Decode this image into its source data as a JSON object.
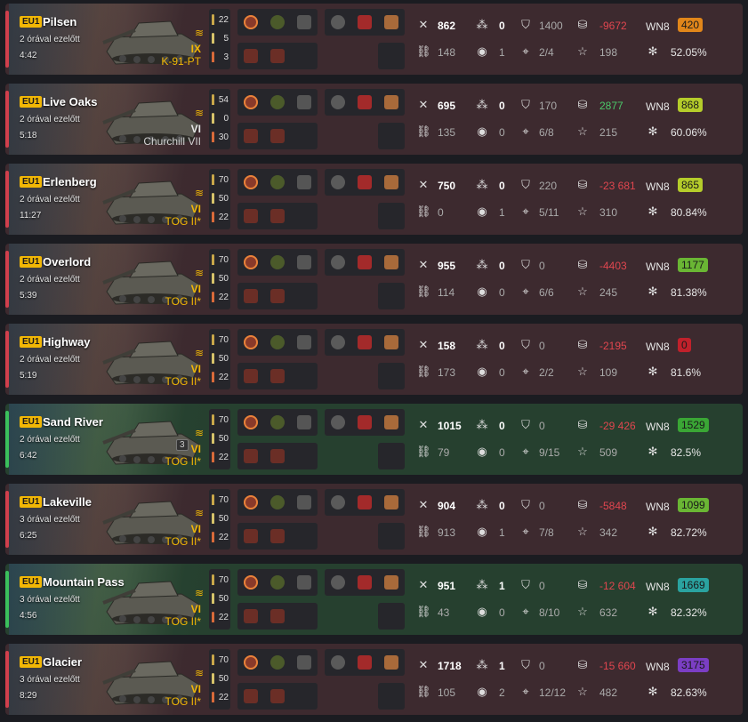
{
  "rows": [
    {
      "result": "loss",
      "server": "EU1",
      "map": "Pilsen",
      "ago": "2 órával ezelőtt",
      "duration": "4:42",
      "tier": "IX",
      "tank": "K-91-PT",
      "tank_style": "elite",
      "shells": [
        "22",
        "5",
        "3"
      ],
      "damage": "862",
      "kills": "0",
      "blocked": "1400",
      "assist": "148",
      "spotted": "1",
      "hits": "2/4",
      "credits": "-9672",
      "credits_sign": "neg",
      "xp": "198",
      "wn8_label": "WN8",
      "wn8": "420",
      "wn8_color": "#e1861a",
      "winrate": "52.05%",
      "mastery": ""
    },
    {
      "result": "loss",
      "server": "EU1",
      "map": "Live Oaks",
      "ago": "2 órával ezelőtt",
      "duration": "5:18",
      "tier": "VI",
      "tank": "Churchill VII",
      "tank_style": "std",
      "shells": [
        "54",
        "0",
        "30"
      ],
      "damage": "695",
      "kills": "0",
      "blocked": "170",
      "assist": "135",
      "spotted": "0",
      "hits": "6/8",
      "credits": "2877",
      "credits_sign": "pos",
      "xp": "215",
      "wn8_label": "WN8",
      "wn8": "868",
      "wn8_color": "#b5cc2a",
      "winrate": "60.06%",
      "mastery": ""
    },
    {
      "result": "loss",
      "server": "EU1",
      "map": "Erlenberg",
      "ago": "2 órával ezelőtt",
      "duration": "11:27",
      "tier": "VI",
      "tank": "TOG II*",
      "tank_style": "elite",
      "shells": [
        "70",
        "50",
        "22"
      ],
      "damage": "750",
      "kills": "0",
      "blocked": "220",
      "assist": "0",
      "spotted": "1",
      "hits": "5/11",
      "credits": "-23 681",
      "credits_sign": "neg",
      "xp": "310",
      "wn8_label": "WN8",
      "wn8": "865",
      "wn8_color": "#b5cc2a",
      "winrate": "80.84%",
      "mastery": ""
    },
    {
      "result": "loss",
      "server": "EU1",
      "map": "Overlord",
      "ago": "2 órával ezelőtt",
      "duration": "5:39",
      "tier": "VI",
      "tank": "TOG II*",
      "tank_style": "elite",
      "shells": [
        "70",
        "50",
        "22"
      ],
      "damage": "955",
      "kills": "0",
      "blocked": "0",
      "assist": "114",
      "spotted": "0",
      "hits": "6/6",
      "credits": "-4403",
      "credits_sign": "neg",
      "xp": "245",
      "wn8_label": "WN8",
      "wn8": "1177",
      "wn8_color": "#6ab634",
      "winrate": "81.38%",
      "mastery": ""
    },
    {
      "result": "loss",
      "server": "EU1",
      "map": "Highway",
      "ago": "2 órával ezelőtt",
      "duration": "5:19",
      "tier": "VI",
      "tank": "TOG II*",
      "tank_style": "elite",
      "shells": [
        "70",
        "50",
        "22"
      ],
      "damage": "158",
      "kills": "0",
      "blocked": "0",
      "assist": "173",
      "spotted": "0",
      "hits": "2/2",
      "credits": "-2195",
      "credits_sign": "neg",
      "xp": "109",
      "wn8_label": "WN8",
      "wn8": "0",
      "wn8_color": "#c0212b",
      "winrate": "81.6%",
      "mastery": ""
    },
    {
      "result": "win",
      "server": "EU1",
      "map": "Sand River",
      "ago": "2 órával ezelőtt",
      "duration": "6:42",
      "tier": "VI",
      "tank": "TOG II*",
      "tank_style": "elite",
      "shells": [
        "70",
        "50",
        "22"
      ],
      "damage": "1015",
      "kills": "0",
      "blocked": "0",
      "assist": "79",
      "spotted": "0",
      "hits": "9/15",
      "credits": "-29 426",
      "credits_sign": "neg",
      "xp": "509",
      "wn8_label": "WN8",
      "wn8": "1529",
      "wn8_color": "#3aa635",
      "winrate": "82.5%",
      "mastery": "3"
    },
    {
      "result": "loss",
      "server": "EU1",
      "map": "Lakeville",
      "ago": "3 órával ezelőtt",
      "duration": "6:25",
      "tier": "VI",
      "tank": "TOG II*",
      "tank_style": "elite",
      "shells": [
        "70",
        "50",
        "22"
      ],
      "damage": "904",
      "kills": "0",
      "blocked": "0",
      "assist": "913",
      "spotted": "1",
      "hits": "7/8",
      "credits": "-5848",
      "credits_sign": "neg",
      "xp": "342",
      "wn8_label": "WN8",
      "wn8": "1099",
      "wn8_color": "#6ab634",
      "winrate": "82.72%",
      "mastery": ""
    },
    {
      "result": "win",
      "server": "EU1",
      "map": "Mountain Pass",
      "ago": "3 órával ezelőtt",
      "duration": "4:56",
      "tier": "VI",
      "tank": "TOG II*",
      "tank_style": "elite",
      "shells": [
        "70",
        "50",
        "22"
      ],
      "damage": "951",
      "kills": "1",
      "blocked": "0",
      "assist": "43",
      "spotted": "0",
      "hits": "8/10",
      "credits": "-12 604",
      "credits_sign": "neg",
      "xp": "632",
      "wn8_label": "WN8",
      "wn8": "1669",
      "wn8_color": "#2aa3a0",
      "winrate": "82.32%",
      "mastery": ""
    },
    {
      "result": "loss",
      "server": "EU1",
      "map": "Glacier",
      "ago": "3 órával ezelőtt",
      "duration": "8:29",
      "tier": "VI",
      "tank": "TOG II*",
      "tank_style": "elite",
      "shells": [
        "70",
        "50",
        "22"
      ],
      "damage": "1718",
      "kills": "1",
      "blocked": "0",
      "assist": "105",
      "spotted": "2",
      "hits": "12/12",
      "credits": "-15 660",
      "credits_sign": "neg",
      "xp": "482",
      "wn8_label": "WN8",
      "wn8": "3175",
      "wn8_color": "#7b3ec4",
      "winrate": "82.63%",
      "mastery": ""
    }
  ]
}
